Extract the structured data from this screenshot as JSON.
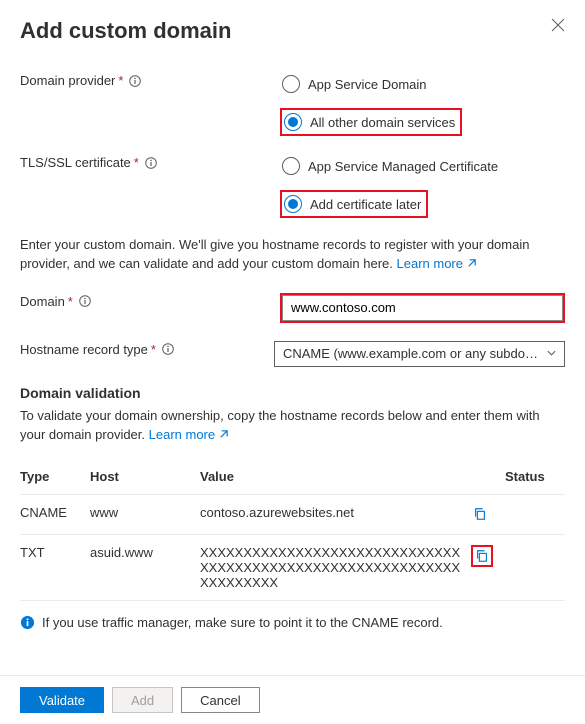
{
  "title": "Add custom domain",
  "labels": {
    "domain_provider": "Domain provider",
    "tls": "TLS/SSL certificate",
    "domain": "Domain",
    "hostname_record_type": "Hostname record type"
  },
  "radio": {
    "provider_app_service": "App Service Domain",
    "provider_other": "All other domain services",
    "cert_managed": "App Service Managed Certificate",
    "cert_later": "Add certificate later"
  },
  "desc1_a": "Enter your custom domain. We'll give you hostname records to register with your domain provider, and we can validate and add your custom domain here. ",
  "learn_more": "Learn more",
  "domain_value": "www.contoso.com",
  "hostname_select": "CNAME (www.example.com or any subdo…",
  "validation_heading": "Domain validation",
  "validation_desc": "To validate your domain ownership, copy the hostname records below and enter them with your domain provider. ",
  "table": {
    "headers": {
      "type": "Type",
      "host": "Host",
      "value": "Value",
      "status": "Status"
    },
    "rows": [
      {
        "type": "CNAME",
        "host": "www",
        "value": "contoso.azurewebsites.net"
      },
      {
        "type": "TXT",
        "host": "asuid.www",
        "value": "XXXXXXXXXXXXXXXXXXXXXXXXXXXXXXXXXXXXXXXXXXXXXXXXXXXXXXXXXXXXXXXXXXXXX"
      }
    ]
  },
  "note": "If you use traffic manager, make sure to point it to the CNAME record.",
  "buttons": {
    "validate": "Validate",
    "add": "Add",
    "cancel": "Cancel"
  }
}
